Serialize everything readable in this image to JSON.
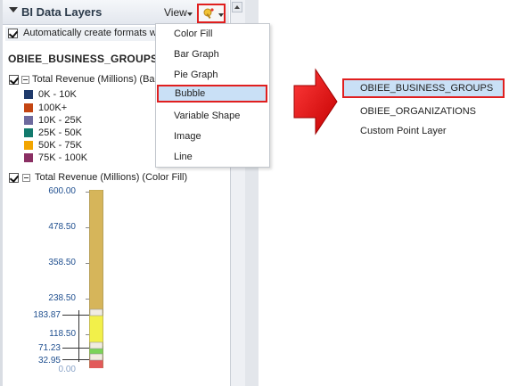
{
  "panel": {
    "title": "BI Data Layers",
    "view_label": "View",
    "auto_create_label": "Automatically create formats w",
    "group_name": "OBIEE_BUSINESS_GROUPS",
    "bar_layer_title": "Total Revenue (Millions) (Bar",
    "legend": [
      {
        "label": "0K - 10K",
        "color": "#1f3a6b"
      },
      {
        "label": "100K+",
        "color": "#c44512"
      },
      {
        "label": "10K - 25K",
        "color": "#6e6a9e"
      },
      {
        "label": "25K - 50K",
        "color": "#127a6d"
      },
      {
        "label": "50K - 75K",
        "color": "#f2a500"
      },
      {
        "label": "75K - 100K",
        "color": "#8a2f63"
      }
    ],
    "color_layer_title": "Total Revenue (Millions) (Color Fill)",
    "scale_ticks": [
      "600.00",
      "478.50",
      "358.50",
      "238.50",
      "183.87",
      "118.50",
      "71.23",
      "32.95",
      "0.00"
    ]
  },
  "menu": {
    "items": [
      "Color Fill",
      "Bar Graph",
      "Pie Graph",
      "Bubble",
      "Variable Shape",
      "Image",
      "Line"
    ],
    "selected": "Bubble"
  },
  "submenu": {
    "items": [
      "OBIEE_BUSINESS_GROUPS",
      "OBIEE_ORGANIZATIONS",
      "Custom Point Layer"
    ]
  },
  "colors": {
    "highlight_border": "#e01f1f",
    "highlight_fill": "#c9e0f6",
    "scale_top": "#d6b55a",
    "scale_yellow": "#f2f04a",
    "scale_green": "#7bd35a",
    "scale_red": "#e25a5a"
  }
}
